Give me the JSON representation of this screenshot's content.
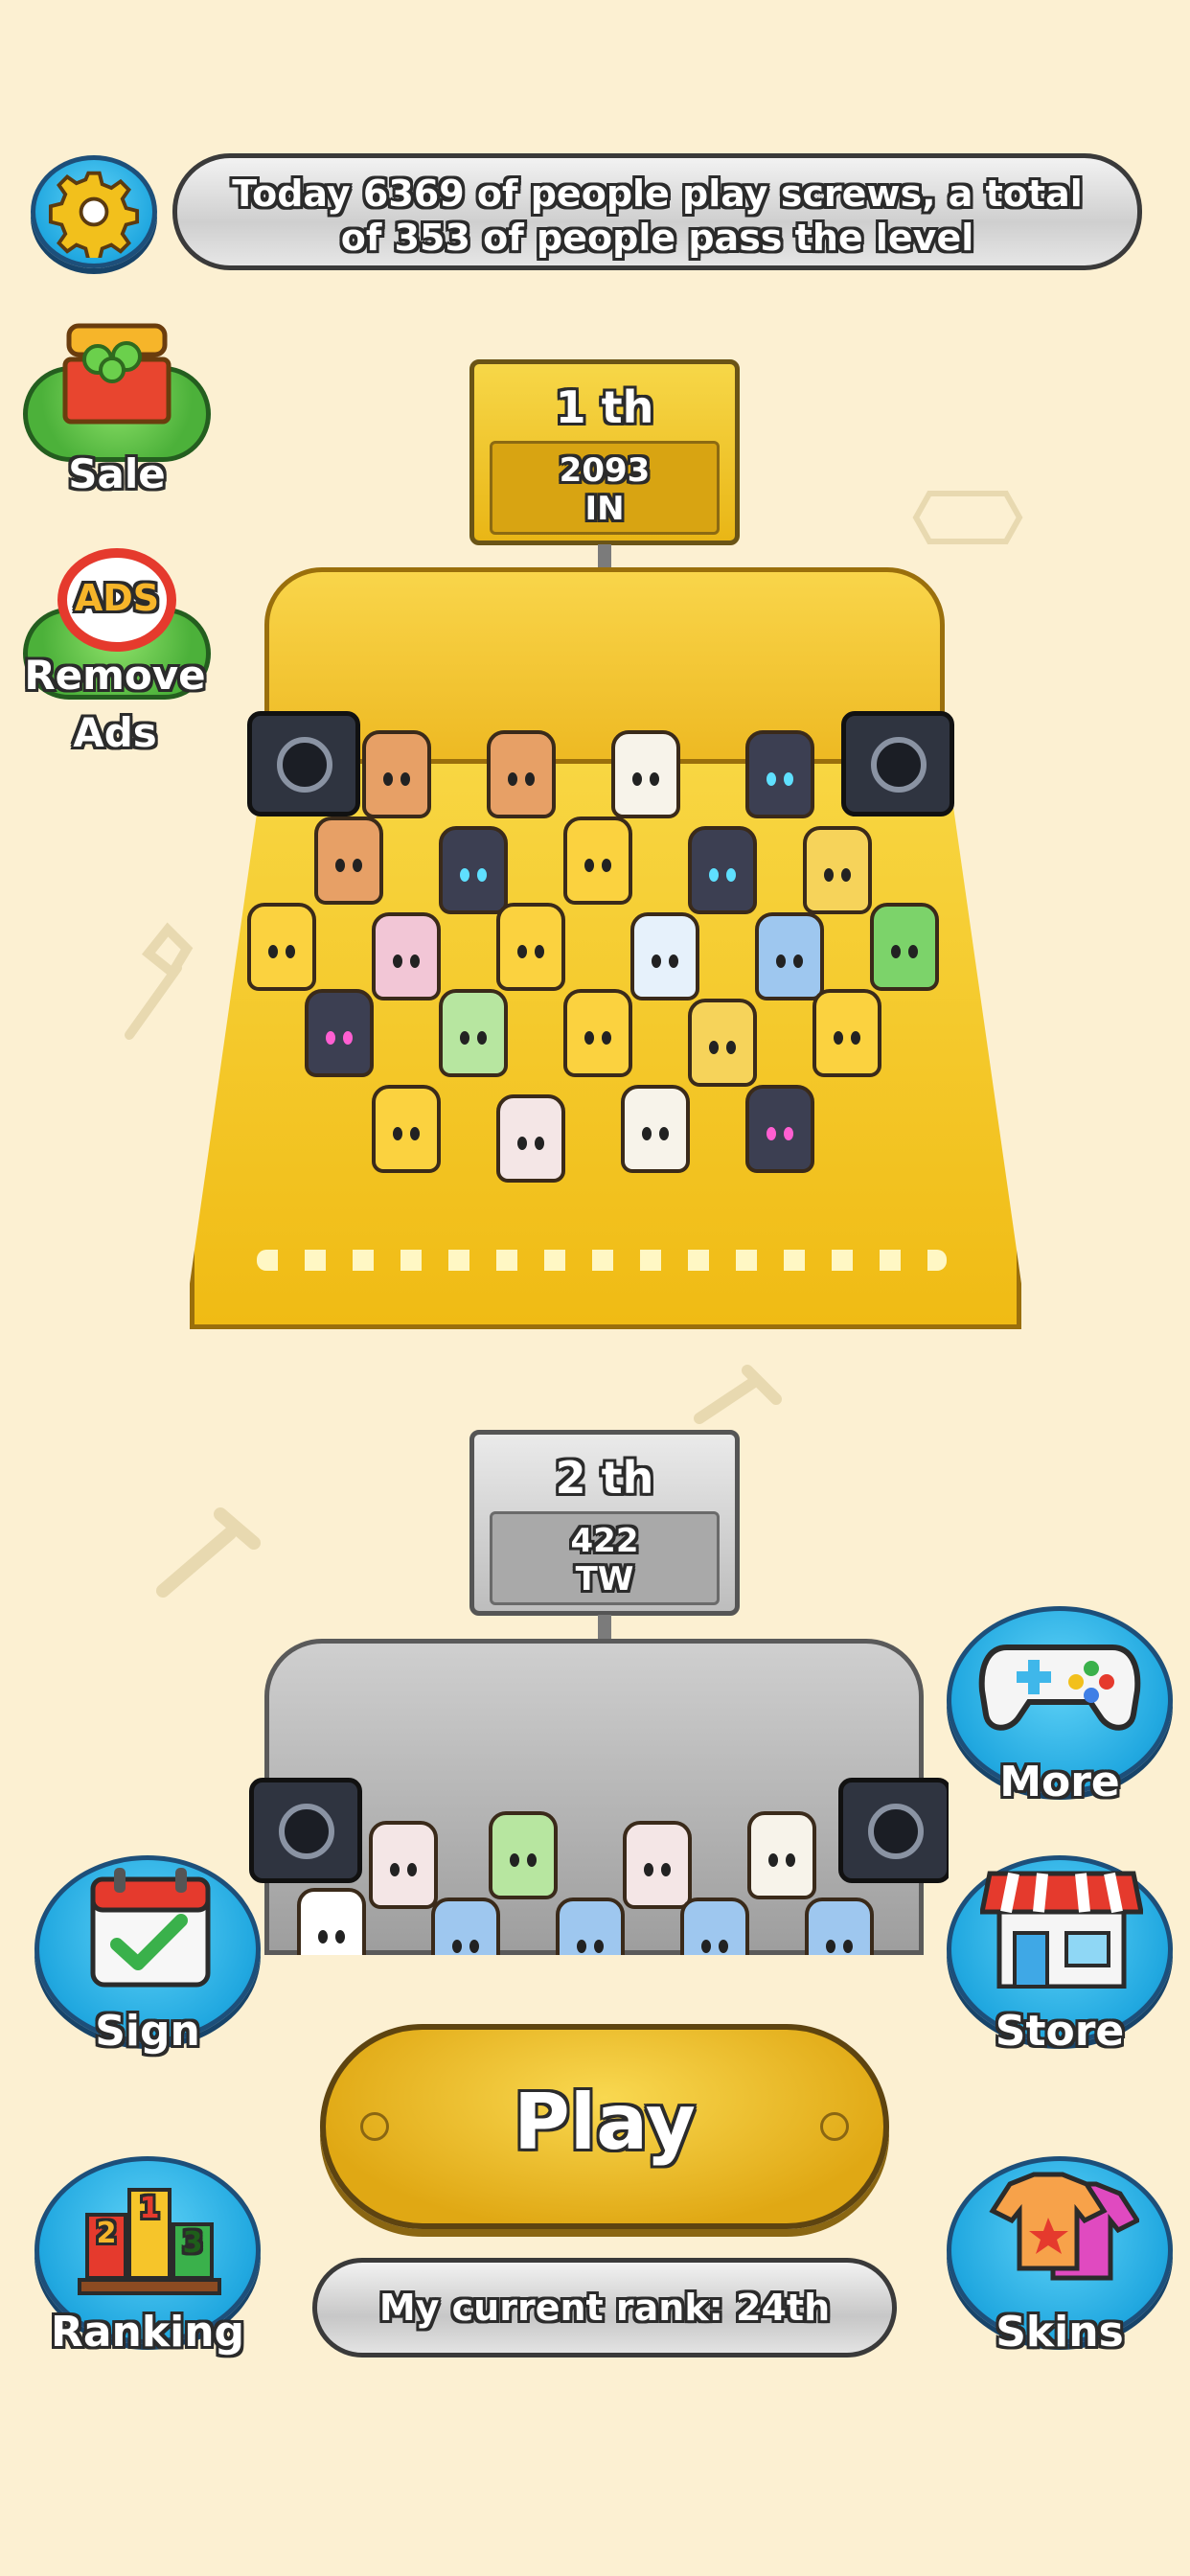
{
  "header": {
    "stats_line1": "Today 6369 of people play screws, a total",
    "stats_line2": "of 353 of people pass the level"
  },
  "left_menu": {
    "sale_label": "Sale",
    "remove_ads_label_1": "Remove",
    "remove_ads_label_2": "Ads",
    "ads_badge": "ADS"
  },
  "podium_first": {
    "rank": "1 th",
    "score": "2093",
    "country": "IN"
  },
  "podium_second": {
    "rank": "2 th",
    "score": "422",
    "country": "TW"
  },
  "buttons": {
    "more": "More",
    "sign": "Sign",
    "store": "Store",
    "ranking": "Ranking",
    "skins": "Skins",
    "play": "Play",
    "ranking_icon_numbers": [
      "2",
      "1",
      "3"
    ]
  },
  "footer": {
    "current_rank": "My current rank: 24th"
  },
  "colors": {
    "background": "#fcf0d2",
    "gold": "#f3c623",
    "silver": "#c9c9c9",
    "button_blue": "#21a8e0",
    "sale_green": "#4cb13a"
  },
  "icons": {
    "settings": "gear-icon",
    "sale": "treasure-chest-icon",
    "remove_ads": "no-ads-icon",
    "more": "gamepad-icon",
    "sign": "calendar-check-icon",
    "store": "shop-icon",
    "ranking": "podium-icon",
    "skins": "tshirt-icon"
  }
}
